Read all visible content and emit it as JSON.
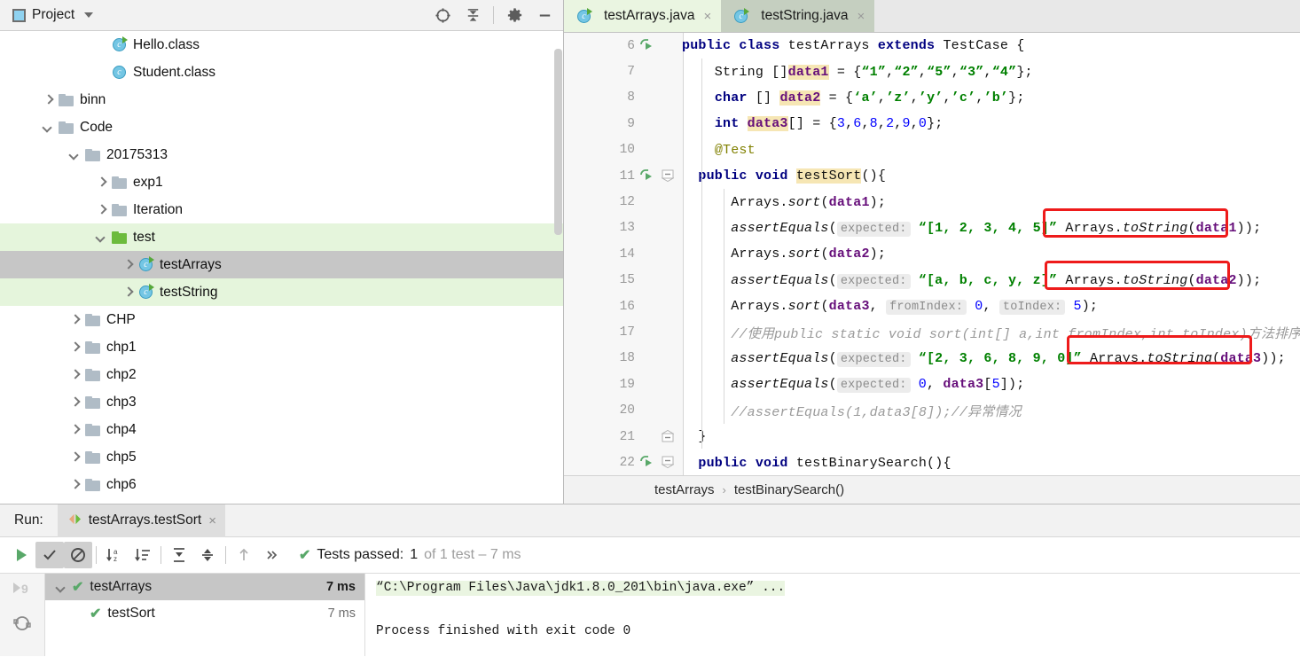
{
  "project_panel": {
    "title": "Project",
    "icons": [
      "locate-icon",
      "collapse-all-icon",
      "settings-gear-icon",
      "minimize-icon"
    ],
    "tree": [
      {
        "label": "Hello.class",
        "indent": 3,
        "arrow": "none",
        "icon": "class-run-icon",
        "state": "none"
      },
      {
        "label": "Student.class",
        "indent": 3,
        "arrow": "none",
        "icon": "class-icon",
        "state": "none"
      },
      {
        "label": "binn",
        "indent": 1,
        "arrow": "right",
        "icon": "folder-icon",
        "state": "none"
      },
      {
        "label": "Code",
        "indent": 1,
        "arrow": "down",
        "icon": "folder-icon",
        "state": "none"
      },
      {
        "label": "20175313",
        "indent": 2,
        "arrow": "down",
        "icon": "folder-icon",
        "state": "none"
      },
      {
        "label": "exp1",
        "indent": 3,
        "arrow": "right",
        "icon": "folder-icon",
        "state": "none"
      },
      {
        "label": "Iteration",
        "indent": 3,
        "arrow": "right",
        "icon": "folder-icon",
        "state": "none"
      },
      {
        "label": "test",
        "indent": 3,
        "arrow": "down",
        "icon": "folder-green-icon",
        "state": "green"
      },
      {
        "label": "testArrays",
        "indent": 4,
        "arrow": "right",
        "icon": "class-run-icon",
        "state": "gray"
      },
      {
        "label": "testString",
        "indent": 4,
        "arrow": "right",
        "icon": "class-run-icon",
        "state": "green"
      },
      {
        "label": "CHP",
        "indent": 2,
        "arrow": "right",
        "icon": "folder-icon",
        "state": "none"
      },
      {
        "label": "chp1",
        "indent": 2,
        "arrow": "right",
        "icon": "folder-icon",
        "state": "none"
      },
      {
        "label": "chp2",
        "indent": 2,
        "arrow": "right",
        "icon": "folder-icon",
        "state": "none"
      },
      {
        "label": "chp3",
        "indent": 2,
        "arrow": "right",
        "icon": "folder-icon",
        "state": "none"
      },
      {
        "label": "chp4",
        "indent": 2,
        "arrow": "right",
        "icon": "folder-icon",
        "state": "none"
      },
      {
        "label": "chp5",
        "indent": 2,
        "arrow": "right",
        "icon": "folder-icon",
        "state": "none"
      },
      {
        "label": "chp6",
        "indent": 2,
        "arrow": "right",
        "icon": "folder-icon",
        "state": "none"
      }
    ]
  },
  "editor": {
    "tabs": [
      {
        "label": "testArrays.java",
        "active": true,
        "close": "×"
      },
      {
        "label": "testString.java",
        "active": false,
        "close": "×"
      }
    ],
    "first_line_number": 6,
    "lines": [
      {
        "n": 6,
        "run": true,
        "fold": "none"
      },
      {
        "n": 7,
        "run": false,
        "fold": "none"
      },
      {
        "n": 8,
        "run": false,
        "fold": "none"
      },
      {
        "n": 9,
        "run": false,
        "fold": "none"
      },
      {
        "n": 10,
        "run": false,
        "fold": "none"
      },
      {
        "n": 11,
        "run": true,
        "fold": "open"
      },
      {
        "n": 12,
        "run": false,
        "fold": "none"
      },
      {
        "n": 13,
        "run": false,
        "fold": "none"
      },
      {
        "n": 14,
        "run": false,
        "fold": "none"
      },
      {
        "n": 15,
        "run": false,
        "fold": "none"
      },
      {
        "n": 16,
        "run": false,
        "fold": "none"
      },
      {
        "n": 17,
        "run": false,
        "fold": "none"
      },
      {
        "n": 18,
        "run": false,
        "fold": "none"
      },
      {
        "n": 19,
        "run": false,
        "fold": "none"
      },
      {
        "n": 20,
        "run": false,
        "fold": "none"
      },
      {
        "n": 21,
        "run": false,
        "fold": "close"
      },
      {
        "n": 22,
        "run": true,
        "fold": "open"
      }
    ],
    "code_text": {
      "l6": "public class testArrays extends TestCase {",
      "l7": "String []data1 = {“1”,“2”,“5”,“3”,“4”};",
      "l8": "char [] data2 = {‘a’,’z’,’y’,’c’,’b’};",
      "l9": "int data3[] = {3,6,8,2,9,0};",
      "l10": "@Test",
      "l11": "public void testSort(){",
      "l12": "Arrays.sort(data1);",
      "l13": "assertEquals( expected: “[1, 2, 3, 4, 5]” Arrays.toString(data1));",
      "l14": "Arrays.sort(data2);",
      "l15": "assertEquals( expected: “[a, b, c, y, z]” Arrays.toString(data2));",
      "l16": "Arrays.sort(data3, fromIndex: 0, toIndex: 5);",
      "l17": "//使用public static void sort(int[] a,int fromIndex,int toIndex)方法排序",
      "l18": "assertEquals( expected: “[2, 3, 6, 8, 9, 0]” Arrays.toString(data3));",
      "l19": "assertEquals( expected: 0, data3[5]);",
      "l20": "//assertEquals(1,data3[8]);//异常情况",
      "l21": "}",
      "l22": "public void testBinarySearch(){"
    },
    "annotations": [
      {
        "name": "redbox-tostring-data1",
        "target": "Arrays.toString(data1)"
      },
      {
        "name": "redbox-tostring-data2",
        "target": "Arrays.toString(data2)"
      },
      {
        "name": "redbox-tostring-data3",
        "target": "Arrays.toString(data3)"
      }
    ],
    "breadcrumb": [
      "testArrays",
      "testBinarySearch()"
    ],
    "breadcrumb_separator": "›"
  },
  "run_panel": {
    "label": "Run:",
    "tab": {
      "label": "testArrays.testSort",
      "close": "×",
      "icon": "run-config-icon"
    },
    "toolbar_icons": [
      "rerun-icon",
      "show-passed-icon",
      "hide-ignored-icon",
      "sort-alphabetically-icon",
      "sort-duration-icon",
      "expand-all-icon",
      "collapse-all-icon",
      "up-arrow-icon",
      "more-icon"
    ],
    "status": {
      "prefix": "Tests passed:",
      "count": "1",
      "suffix": "of 1 test – 7 ms",
      "check": "✔"
    },
    "side_icons": [
      "run-to-cursor-icon",
      "rerun-failed-icon"
    ],
    "tests": [
      {
        "label": "testArrays",
        "time": "7 ms",
        "indent": 0,
        "selected": true,
        "expanded": true,
        "status": "passed"
      },
      {
        "label": "testSort",
        "time": "7 ms",
        "indent": 1,
        "selected": false,
        "expanded": false,
        "status": "passed"
      }
    ],
    "console": {
      "line1": "“C:\\Program Files\\Java\\jdk1.8.0_201\\bin\\java.exe” ...",
      "line2": "Process finished with exit code 0"
    }
  },
  "colors": {
    "accent_green": "#59a869",
    "selection_green": "#e5f5dc",
    "selection_gray": "#c6c6c6",
    "annotation_red": "#ee1b1b",
    "keyword_blue": "#000080",
    "string_green": "#008000",
    "field_purple": "#660e7a"
  }
}
